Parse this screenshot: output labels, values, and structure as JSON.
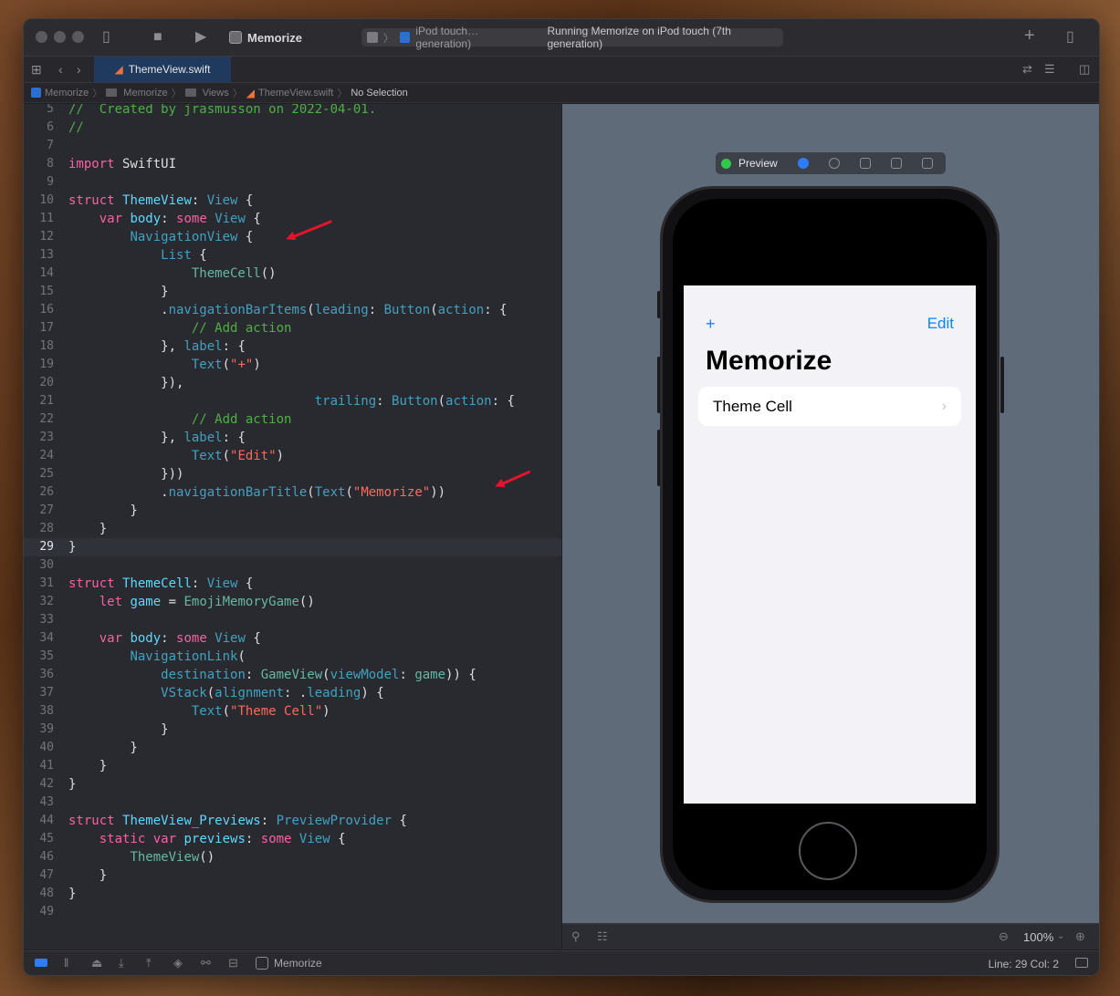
{
  "toolbar": {
    "scheme_name": "Memorize",
    "activity_device": "iPod touch…generation)",
    "activity_status": "Running Memorize on iPod touch (7th generation)"
  },
  "tabs": [
    {
      "label": "ThemeView.swift"
    }
  ],
  "jumpbar": {
    "items": [
      "Memorize",
      "Memorize",
      "Views",
      "ThemeView.swift"
    ],
    "last": "No Selection"
  },
  "editor": {
    "current_line": 29,
    "lines": [
      {
        "n": "5",
        "tokens": [
          {
            "t": "//  Created by jrasmusson on 2022-04-01.",
            "c": "cm2"
          }
        ]
      },
      {
        "n": "6",
        "tokens": [
          {
            "t": "//",
            "c": "cm2"
          }
        ]
      },
      {
        "n": "7",
        "tokens": []
      },
      {
        "n": "8",
        "tokens": [
          {
            "t": "import",
            "c": "kw"
          },
          {
            "t": " SwiftUI",
            "c": "plain"
          }
        ]
      },
      {
        "n": "9",
        "tokens": []
      },
      {
        "n": "10",
        "tokens": [
          {
            "t": "struct",
            "c": "kw"
          },
          {
            "t": " ",
            "c": "plain"
          },
          {
            "t": "ThemeView",
            "c": "ty"
          },
          {
            "t": ": ",
            "c": "plain"
          },
          {
            "t": "View",
            "c": "tx"
          },
          {
            "t": " {",
            "c": "plain"
          }
        ]
      },
      {
        "n": "11",
        "tokens": [
          {
            "t": "    ",
            "c": "plain"
          },
          {
            "t": "var",
            "c": "kw"
          },
          {
            "t": " ",
            "c": "plain"
          },
          {
            "t": "body",
            "c": "ty"
          },
          {
            "t": ": ",
            "c": "plain"
          },
          {
            "t": "some",
            "c": "kw"
          },
          {
            "t": " ",
            "c": "plain"
          },
          {
            "t": "View",
            "c": "tx"
          },
          {
            "t": " {",
            "c": "plain"
          }
        ]
      },
      {
        "n": "12",
        "tokens": [
          {
            "t": "        ",
            "c": "plain"
          },
          {
            "t": "NavigationView",
            "c": "tx"
          },
          {
            "t": " {",
            "c": "plain"
          }
        ]
      },
      {
        "n": "13",
        "tokens": [
          {
            "t": "            ",
            "c": "plain"
          },
          {
            "t": "List",
            "c": "tx"
          },
          {
            "t": " {",
            "c": "plain"
          }
        ]
      },
      {
        "n": "14",
        "tokens": [
          {
            "t": "                ",
            "c": "plain"
          },
          {
            "t": "ThemeCell",
            "c": "fn"
          },
          {
            "t": "()",
            "c": "plain"
          }
        ]
      },
      {
        "n": "15",
        "tokens": [
          {
            "t": "            }",
            "c": "plain"
          }
        ]
      },
      {
        "n": "16",
        "tokens": [
          {
            "t": "            .",
            "c": "plain"
          },
          {
            "t": "navigationBarItems",
            "c": "tx"
          },
          {
            "t": "(",
            "c": "plain"
          },
          {
            "t": "leading",
            "c": "tx"
          },
          {
            "t": ": ",
            "c": "plain"
          },
          {
            "t": "Button",
            "c": "tx"
          },
          {
            "t": "(",
            "c": "plain"
          },
          {
            "t": "action",
            "c": "tx"
          },
          {
            "t": ": {",
            "c": "plain"
          }
        ]
      },
      {
        "n": "17",
        "tokens": [
          {
            "t": "                ",
            "c": "plain"
          },
          {
            "t": "// Add action",
            "c": "cm2"
          }
        ]
      },
      {
        "n": "18",
        "tokens": [
          {
            "t": "            }, ",
            "c": "plain"
          },
          {
            "t": "label",
            "c": "tx"
          },
          {
            "t": ": {",
            "c": "plain"
          }
        ]
      },
      {
        "n": "19",
        "tokens": [
          {
            "t": "                ",
            "c": "plain"
          },
          {
            "t": "Text",
            "c": "tx"
          },
          {
            "t": "(",
            "c": "plain"
          },
          {
            "t": "\"+\"",
            "c": "str"
          },
          {
            "t": ")",
            "c": "plain"
          }
        ]
      },
      {
        "n": "20",
        "tokens": [
          {
            "t": "            }),",
            "c": "plain"
          }
        ]
      },
      {
        "n": "21",
        "tokens": [
          {
            "t": "                                ",
            "c": "plain"
          },
          {
            "t": "trailing",
            "c": "tx"
          },
          {
            "t": ": ",
            "c": "plain"
          },
          {
            "t": "Button",
            "c": "tx"
          },
          {
            "t": "(",
            "c": "plain"
          },
          {
            "t": "action",
            "c": "tx"
          },
          {
            "t": ": {",
            "c": "plain"
          }
        ]
      },
      {
        "n": "22",
        "tokens": [
          {
            "t": "                ",
            "c": "plain"
          },
          {
            "t": "// Add action",
            "c": "cm2"
          }
        ]
      },
      {
        "n": "23",
        "tokens": [
          {
            "t": "            }, ",
            "c": "plain"
          },
          {
            "t": "label",
            "c": "tx"
          },
          {
            "t": ": {",
            "c": "plain"
          }
        ]
      },
      {
        "n": "24",
        "tokens": [
          {
            "t": "                ",
            "c": "plain"
          },
          {
            "t": "Text",
            "c": "tx"
          },
          {
            "t": "(",
            "c": "plain"
          },
          {
            "t": "\"Edit\"",
            "c": "str"
          },
          {
            "t": ")",
            "c": "plain"
          }
        ]
      },
      {
        "n": "25",
        "tokens": [
          {
            "t": "            }))",
            "c": "plain"
          }
        ]
      },
      {
        "n": "26",
        "tokens": [
          {
            "t": "            .",
            "c": "plain"
          },
          {
            "t": "navigationBarTitle",
            "c": "tx"
          },
          {
            "t": "(",
            "c": "plain"
          },
          {
            "t": "Text",
            "c": "tx"
          },
          {
            "t": "(",
            "c": "plain"
          },
          {
            "t": "\"Memorize\"",
            "c": "str"
          },
          {
            "t": "))",
            "c": "plain"
          }
        ]
      },
      {
        "n": "27",
        "tokens": [
          {
            "t": "        }",
            "c": "plain"
          }
        ]
      },
      {
        "n": "28",
        "tokens": [
          {
            "t": "    }",
            "c": "plain"
          }
        ]
      },
      {
        "n": "29",
        "tokens": [
          {
            "t": "}",
            "c": "plain"
          }
        ]
      },
      {
        "n": "30",
        "tokens": []
      },
      {
        "n": "31",
        "tokens": [
          {
            "t": "struct",
            "c": "kw"
          },
          {
            "t": " ",
            "c": "plain"
          },
          {
            "t": "ThemeCell",
            "c": "ty"
          },
          {
            "t": ": ",
            "c": "plain"
          },
          {
            "t": "View",
            "c": "tx"
          },
          {
            "t": " {",
            "c": "plain"
          }
        ]
      },
      {
        "n": "32",
        "tokens": [
          {
            "t": "    ",
            "c": "plain"
          },
          {
            "t": "let",
            "c": "kw"
          },
          {
            "t": " ",
            "c": "plain"
          },
          {
            "t": "game",
            "c": "ty"
          },
          {
            "t": " = ",
            "c": "plain"
          },
          {
            "t": "EmojiMemoryGame",
            "c": "fn"
          },
          {
            "t": "()",
            "c": "plain"
          }
        ]
      },
      {
        "n": "33",
        "tokens": []
      },
      {
        "n": "34",
        "tokens": [
          {
            "t": "    ",
            "c": "plain"
          },
          {
            "t": "var",
            "c": "kw"
          },
          {
            "t": " ",
            "c": "plain"
          },
          {
            "t": "body",
            "c": "ty"
          },
          {
            "t": ": ",
            "c": "plain"
          },
          {
            "t": "some",
            "c": "kw"
          },
          {
            "t": " ",
            "c": "plain"
          },
          {
            "t": "View",
            "c": "tx"
          },
          {
            "t": " {",
            "c": "plain"
          }
        ]
      },
      {
        "n": "35",
        "tokens": [
          {
            "t": "        ",
            "c": "plain"
          },
          {
            "t": "NavigationLink",
            "c": "tx"
          },
          {
            "t": "(",
            "c": "plain"
          }
        ]
      },
      {
        "n": "36",
        "tokens": [
          {
            "t": "            ",
            "c": "plain"
          },
          {
            "t": "destination",
            "c": "tx"
          },
          {
            "t": ": ",
            "c": "plain"
          },
          {
            "t": "GameView",
            "c": "fn"
          },
          {
            "t": "(",
            "c": "plain"
          },
          {
            "t": "viewModel",
            "c": "tx"
          },
          {
            "t": ": ",
            "c": "plain"
          },
          {
            "t": "game",
            "c": "fn"
          },
          {
            "t": ")) {",
            "c": "plain"
          }
        ]
      },
      {
        "n": "37",
        "tokens": [
          {
            "t": "            ",
            "c": "plain"
          },
          {
            "t": "VStack",
            "c": "tx"
          },
          {
            "t": "(",
            "c": "plain"
          },
          {
            "t": "alignment",
            "c": "tx"
          },
          {
            "t": ": .",
            "c": "plain"
          },
          {
            "t": "leading",
            "c": "tx"
          },
          {
            "t": ") {",
            "c": "plain"
          }
        ]
      },
      {
        "n": "38",
        "tokens": [
          {
            "t": "                ",
            "c": "plain"
          },
          {
            "t": "Text",
            "c": "tx"
          },
          {
            "t": "(",
            "c": "plain"
          },
          {
            "t": "\"Theme Cell\"",
            "c": "str"
          },
          {
            "t": ")",
            "c": "plain"
          }
        ]
      },
      {
        "n": "39",
        "tokens": [
          {
            "t": "            }",
            "c": "plain"
          }
        ]
      },
      {
        "n": "40",
        "tokens": [
          {
            "t": "        }",
            "c": "plain"
          }
        ]
      },
      {
        "n": "41",
        "tokens": [
          {
            "t": "    }",
            "c": "plain"
          }
        ]
      },
      {
        "n": "42",
        "tokens": [
          {
            "t": "}",
            "c": "plain"
          }
        ]
      },
      {
        "n": "43",
        "tokens": []
      },
      {
        "n": "44",
        "tokens": [
          {
            "t": "struct",
            "c": "kw"
          },
          {
            "t": " ",
            "c": "plain"
          },
          {
            "t": "ThemeView_Previews",
            "c": "ty"
          },
          {
            "t": ": ",
            "c": "plain"
          },
          {
            "t": "PreviewProvider",
            "c": "tx"
          },
          {
            "t": " {",
            "c": "plain"
          }
        ]
      },
      {
        "n": "45",
        "tokens": [
          {
            "t": "    ",
            "c": "plain"
          },
          {
            "t": "static",
            "c": "kw"
          },
          {
            "t": " ",
            "c": "plain"
          },
          {
            "t": "var",
            "c": "kw"
          },
          {
            "t": " ",
            "c": "plain"
          },
          {
            "t": "previews",
            "c": "ty"
          },
          {
            "t": ": ",
            "c": "plain"
          },
          {
            "t": "some",
            "c": "kw"
          },
          {
            "t": " ",
            "c": "plain"
          },
          {
            "t": "View",
            "c": "tx"
          },
          {
            "t": " {",
            "c": "plain"
          }
        ]
      },
      {
        "n": "46",
        "tokens": [
          {
            "t": "        ",
            "c": "plain"
          },
          {
            "t": "ThemeView",
            "c": "fn"
          },
          {
            "t": "()",
            "c": "plain"
          }
        ]
      },
      {
        "n": "47",
        "tokens": [
          {
            "t": "    }",
            "c": "plain"
          }
        ]
      },
      {
        "n": "48",
        "tokens": [
          {
            "t": "}",
            "c": "plain"
          }
        ]
      },
      {
        "n": "49",
        "tokens": []
      }
    ]
  },
  "preview": {
    "label": "Preview",
    "nav_leading": "+",
    "nav_trailing": "Edit",
    "title": "Memorize",
    "cell_label": "Theme Cell",
    "zoom": "100%"
  },
  "statusbar": {
    "target": "Memorize",
    "position": "Line: 29  Col: 2"
  },
  "colors": {
    "keyword": "#fc5fa3",
    "type_decl": "#5dd8ff",
    "type_ref": "#41a1c0",
    "string": "#fc6a5d",
    "comment": "#4eb044",
    "ios_tint": "#0a84ff",
    "annotation_arrow": "#e3142b"
  }
}
